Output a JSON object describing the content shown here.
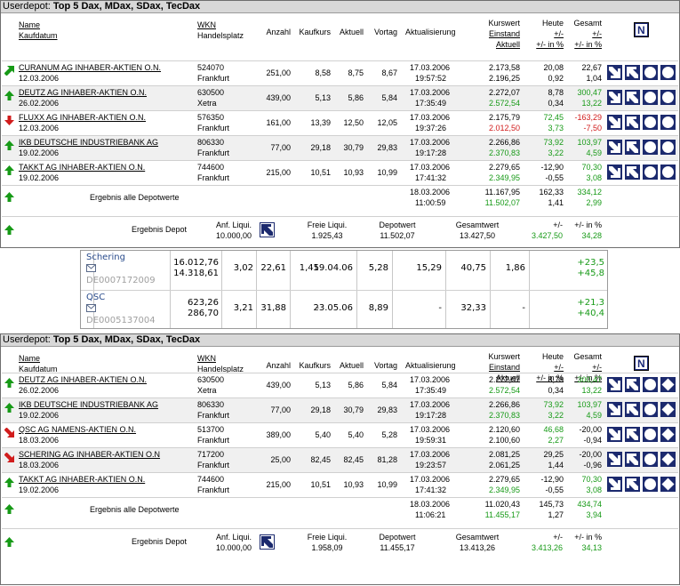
{
  "panel1": {
    "title_prefix": "Userdepot:",
    "title_name": "Top 5 Dax, MDax, SDax, TecDax",
    "headers": {
      "name": "Name",
      "kaufdatum": "Kaufdatum",
      "wkn": "WKN",
      "handelsplatz": "Handelsplatz",
      "anzahl": "Anzahl",
      "kaufkurs": "Kaufkurs",
      "aktuell": "Aktuell",
      "vortag": "Vortag",
      "aktualisierung": "Aktualisierung",
      "kurswert": "Kurswert",
      "einstand": "Einstand",
      "aktuell2": "Aktuell",
      "heute": "Heute",
      "heute_pm": "+/-",
      "heute_pct": "+/- in %",
      "gesamt": "Gesamt",
      "gesamt_pm": "+/-",
      "gesamt_pct": "+/- in %",
      "n_button": "N"
    },
    "rows": [
      {
        "name": "CURANUM AG INHABER-AKTIEN O.N.",
        "kaufdatum": "12.03.2006",
        "wkn": "524070",
        "platz": "Frankfurt",
        "anzahl": "251,00",
        "kaufkurs": "8,58",
        "aktuell": "8,75",
        "vortag": "8,67",
        "datum": "17.03.2006",
        "zeit": "19:57:52",
        "kurswert": "2.173,58",
        "einstand": "2.196,25",
        "heute_pm": "20,08",
        "heute_pct": "0,92",
        "gesamt_pm": "22,67",
        "gesamt_pct": "1,04",
        "trend": "diag-up",
        "einstand_color": "black",
        "heute_color": "black",
        "gesamt_color": "black"
      },
      {
        "name": "DEUTZ AG INHABER-AKTIEN O.N.",
        "kaufdatum": "26.02.2006",
        "wkn": "630500",
        "platz": "Xetra",
        "anzahl": "439,00",
        "kaufkurs": "5,13",
        "aktuell": "5,86",
        "vortag": "5,84",
        "datum": "17.03.2006",
        "zeit": "17:35:49",
        "kurswert": "2.272,07",
        "einstand": "2.572,54",
        "heute_pm": "8,78",
        "heute_pct": "0,34",
        "gesamt_pm": "300,47",
        "gesamt_pct": "13,22",
        "trend": "up",
        "einstand_color": "green",
        "heute_color": "black",
        "gesamt_color": "green"
      },
      {
        "name": "FLUXX AG INHABER-AKTIEN O.N.",
        "kaufdatum": "12.03.2006",
        "wkn": "576350",
        "platz": "Frankfurt",
        "anzahl": "161,00",
        "kaufkurs": "13,39",
        "aktuell": "12,50",
        "vortag": "12,05",
        "datum": "17.03.2006",
        "zeit": "19:37:26",
        "kurswert": "2.175,79",
        "einstand": "2.012,50",
        "heute_pm": "72,45",
        "heute_pct": "3,73",
        "gesamt_pm": "-163,29",
        "gesamt_pct": "-7,50",
        "trend": "down",
        "einstand_color": "red",
        "heute_color": "green",
        "gesamt_color": "red"
      },
      {
        "name": "IKB DEUTSCHE INDUSTRIEBANK AG",
        "kaufdatum": "19.02.2006",
        "wkn": "806330",
        "platz": "Frankfurt",
        "anzahl": "77,00",
        "kaufkurs": "29,18",
        "aktuell": "30,79",
        "vortag": "29,83",
        "datum": "17.03.2006",
        "zeit": "19:17:28",
        "kurswert": "2.266,86",
        "einstand": "2.370,83",
        "heute_pm": "73,92",
        "heute_pct": "3,22",
        "gesamt_pm": "103,97",
        "gesamt_pct": "4,59",
        "trend": "up",
        "einstand_color": "green",
        "heute_color": "green",
        "gesamt_color": "green"
      },
      {
        "name": "TAKKT AG INHABER-AKTIEN O.N.",
        "kaufdatum": "19.02.2006",
        "wkn": "744600",
        "platz": "Frankfurt",
        "anzahl": "215,00",
        "kaufkurs": "10,51",
        "aktuell": "10,93",
        "vortag": "10,99",
        "datum": "17.03.2006",
        "zeit": "17:41:32",
        "kurswert": "2.279,65",
        "einstand": "2.349,95",
        "heute_pm": "-12,90",
        "heute_pct": "-0,55",
        "gesamt_pm": "70,30",
        "gesamt_pct": "3,08",
        "trend": "up",
        "einstand_color": "green",
        "heute_color": "black",
        "gesamt_color": "green"
      }
    ],
    "summary": {
      "label": "Ergebnis alle Depotwerte",
      "datum": "18.03.2006",
      "zeit": "11:00:59",
      "kurswert": "11.167,95",
      "einstand": "11.502,07",
      "heute_pm": "162,33",
      "heute_pct": "1,41",
      "gesamt_pm": "334,12",
      "gesamt_pct": "2,99"
    },
    "depot": {
      "label": "Ergebnis Depot",
      "anf_label": "Anf. Liqui.",
      "anf_value": "10.000,00",
      "freie_label": "Freie Liqui.",
      "freie_value": "1.925,43",
      "depotwert_label": "Depotwert",
      "depotwert_value": "11.502,07",
      "gesamtwert_label": "Gesamtwert",
      "gesamtwert_value": "13.427,50",
      "pm_label": "+/-",
      "pm_value": "3.427,50",
      "pct_label": "+/- in %",
      "pct_value": "34,28"
    }
  },
  "middle": [
    {
      "name": "Schering",
      "isin": "DE0007172009",
      "v1": "16.012,76",
      "v2": "14.318,61",
      "c1": "3,02",
      "c2": "22,61",
      "c3": "1,45",
      "c4": "19.04.06",
      "c5": "5,28",
      "c6": "15,29",
      "c7": "40,75",
      "c8": "1,86",
      "p1": "+23,5",
      "p2": "+45,8"
    },
    {
      "name": "QSC",
      "isin": "DE0005137004",
      "v1": "623,26",
      "v2": "286,70",
      "c1": "3,21",
      "c2": "31,88",
      "c3": "-",
      "c4": "23.05.06",
      "c5": "8,89",
      "c6": "-",
      "c7": "32,33",
      "c8": "-",
      "p1": "+21,3",
      "p2": "+40,4"
    }
  ],
  "panel2": {
    "title_prefix": "Userdepot:",
    "title_name": "Top 5 Dax, MDax, SDax, TecDax",
    "rows": [
      {
        "name": "DEUTZ AG INHABER-AKTIEN O.N.",
        "kaufdatum": "26.02.2006",
        "wkn": "630500",
        "platz": "Xetra",
        "anzahl": "439,00",
        "kaufkurs": "5,13",
        "aktuell": "5,86",
        "vortag": "5,84",
        "datum": "17.03.2006",
        "zeit": "17:35:49",
        "kurswert": "2.272,07",
        "einstand": "2.572,54",
        "heute_pm": "8,78",
        "heute_pct": "0,34",
        "gesamt_pm": "300,47",
        "gesamt_pct": "13,22",
        "trend": "up",
        "einstand_color": "green",
        "heute_color": "black",
        "gesamt_color": "green"
      },
      {
        "name": "IKB DEUTSCHE INDUSTRIEBANK AG",
        "kaufdatum": "19.02.2006",
        "wkn": "806330",
        "platz": "Frankfurt",
        "anzahl": "77,00",
        "kaufkurs": "29,18",
        "aktuell": "30,79",
        "vortag": "29,83",
        "datum": "17.03.2006",
        "zeit": "19:17:28",
        "kurswert": "2.266,86",
        "einstand": "2.370,83",
        "heute_pm": "73,92",
        "heute_pct": "3,22",
        "gesamt_pm": "103,97",
        "gesamt_pct": "4,59",
        "trend": "up",
        "einstand_color": "green",
        "heute_color": "green",
        "gesamt_color": "green"
      },
      {
        "name": "QSC AG NAMENS-AKTIEN O.N.",
        "kaufdatum": "18.03.2006",
        "wkn": "513700",
        "platz": "Frankfurt",
        "anzahl": "389,00",
        "kaufkurs": "5,40",
        "aktuell": "5,40",
        "vortag": "5,28",
        "datum": "17.03.2006",
        "zeit": "19:59:31",
        "kurswert": "2.120,60",
        "einstand": "2.100,60",
        "heute_pm": "46,68",
        "heute_pct": "2,27",
        "gesamt_pm": "-20,00",
        "gesamt_pct": "-0,94",
        "trend": "diag-down",
        "einstand_color": "black",
        "heute_color": "green",
        "gesamt_color": "black"
      },
      {
        "name": "SCHERING AG INHABER-AKTIEN O.N",
        "kaufdatum": "18.03.2006",
        "wkn": "717200",
        "platz": "Frankfurt",
        "anzahl": "25,00",
        "kaufkurs": "82,45",
        "aktuell": "82,45",
        "vortag": "81,28",
        "datum": "17.03.2006",
        "zeit": "19:23:57",
        "kurswert": "2.081,25",
        "einstand": "2.061,25",
        "heute_pm": "29,25",
        "heute_pct": "1,44",
        "gesamt_pm": "-20,00",
        "gesamt_pct": "-0,96",
        "trend": "diag-down",
        "einstand_color": "black",
        "heute_color": "black",
        "gesamt_color": "black"
      },
      {
        "name": "TAKKT AG INHABER-AKTIEN O.N.",
        "kaufdatum": "19.02.2006",
        "wkn": "744600",
        "platz": "Frankfurt",
        "anzahl": "215,00",
        "kaufkurs": "10,51",
        "aktuell": "10,93",
        "vortag": "10,99",
        "datum": "17.03.2006",
        "zeit": "17:41:32",
        "kurswert": "2.279,65",
        "einstand": "2.349,95",
        "heute_pm": "-12,90",
        "heute_pct": "-0,55",
        "gesamt_pm": "70,30",
        "gesamt_pct": "3,08",
        "trend": "up",
        "einstand_color": "green",
        "heute_color": "black",
        "gesamt_color": "green"
      }
    ],
    "summary": {
      "label": "Ergebnis alle Depotwerte",
      "datum": "18.03.2006",
      "zeit": "11:06:21",
      "kurswert": "11.020,43",
      "einstand": "11.455,17",
      "heute_pm": "145,73",
      "heute_pct": "1,27",
      "gesamt_pm": "434,74",
      "gesamt_pct": "3,94"
    },
    "depot": {
      "label": "Ergebnis Depot",
      "anf_label": "Anf. Liqui.",
      "anf_value": "10.000,00",
      "freie_label": "Freie Liqui.",
      "freie_value": "1.958,09",
      "depotwert_label": "Depotwert",
      "depotwert_value": "11.455,17",
      "gesamtwert_label": "Gesamtwert",
      "gesamtwert_value": "13.413,26",
      "pm_label": "+/-",
      "pm_value": "3.413,26",
      "pct_label": "+/- in %",
      "pct_value": "34,13"
    }
  },
  "colors": {
    "green": "#179a17",
    "red": "#d11c1c",
    "navy": "#1c2a6e",
    "header_bg": "#d8d8d8"
  },
  "icons": [
    "arrow-up-icon",
    "arrow-down-icon",
    "arrow-diag-up-icon",
    "arrow-diag-down-icon",
    "sell-icon",
    "buy-icon",
    "circle-icon",
    "diamond-icon",
    "envelope-icon"
  ]
}
